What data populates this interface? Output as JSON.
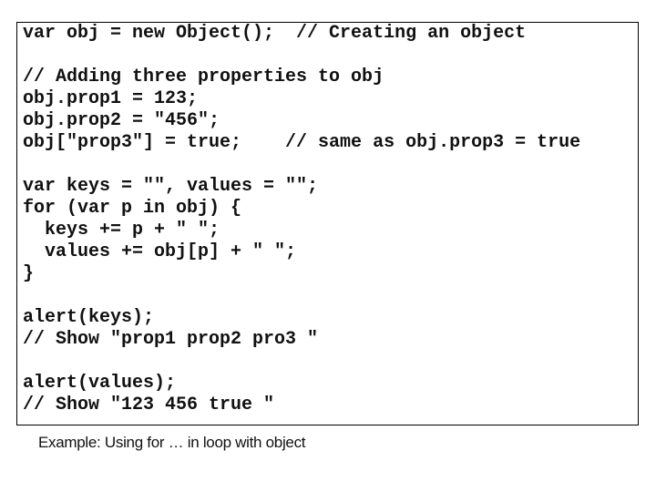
{
  "code_example": {
    "lines": [
      "var obj = new Object();  // Creating an object",
      "",
      "// Adding three properties to obj",
      "obj.prop1 = 123;",
      "obj.prop2 = \"456\";",
      "obj[\"prop3\"] = true;    // same as obj.prop3 = true",
      "",
      "var keys = \"\", values = \"\";",
      "for (var p in obj) {",
      "  keys += p + \" \";",
      "  values += obj[p] + \" \";",
      "}",
      "",
      "alert(keys);",
      "// Show \"prop1 prop2 pro3 \"",
      "",
      "alert(values);",
      "// Show \"123 456 true \""
    ]
  },
  "caption": "Example: Using for … in loop with object"
}
